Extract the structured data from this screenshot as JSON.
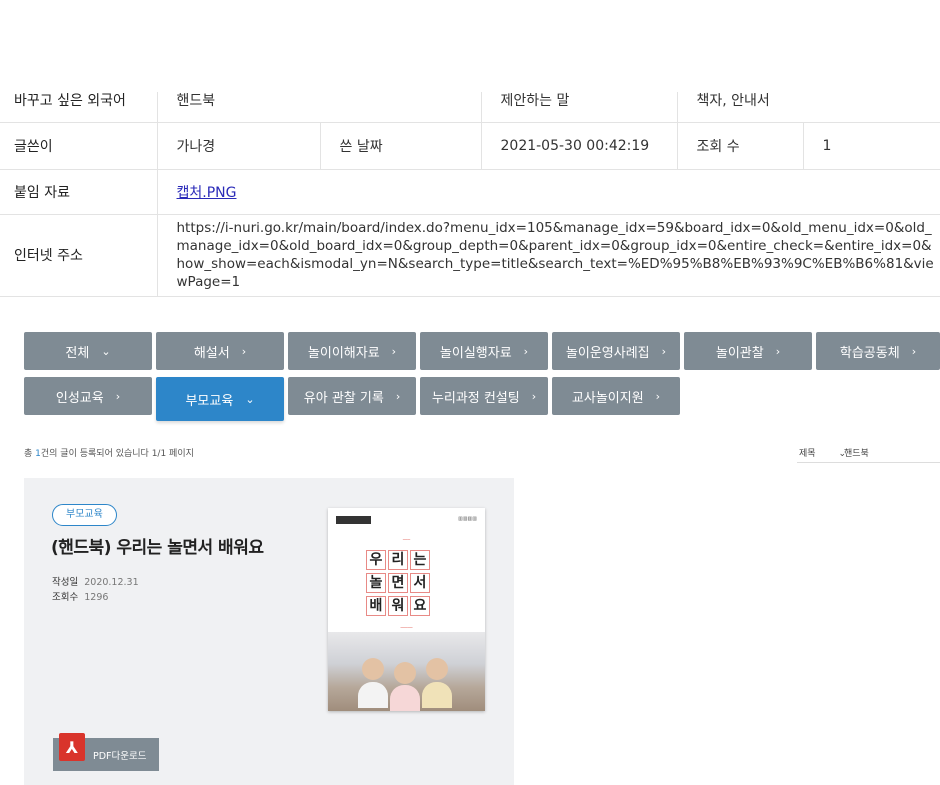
{
  "info": {
    "row_lang_label": "바꾸고 싶은 외국어",
    "row_lang_value": "핸드북",
    "row_suggest_label": "제안하는 말",
    "row_suggest_value": "책자, 안내서",
    "author_label": "글쓴이",
    "author_value": "가나경",
    "date_label": "쓴 날짜",
    "date_value": "2021-05-30 00:42:19",
    "views_label": "조회 수",
    "views_value": "1",
    "attach_label": "붙임 자료",
    "attach_file": "캡처.PNG",
    "url_label": "인터넷 주소",
    "url_value": "https://i-nuri.go.kr/main/board/index.do?menu_idx=105&manage_idx=59&board_idx=0&old_menu_idx=0&old_manage_idx=0&old_board_idx=0&group_depth=0&parent_idx=0&group_idx=0&entire_check=&entire_idx=0&how_show=each&ismodal_yn=N&search_type=title&search_text=%ED%95%B8%EB%93%9C%EB%B6%81&viewPage=1"
  },
  "categories": {
    "row1": [
      "전체",
      "해설서",
      "놀이이해자료",
      "놀이실행자료",
      "놀이운영사례집",
      "놀이관찰",
      "학습공동체"
    ],
    "row2": [
      "인성교육",
      "부모교육",
      "유아 관찰 기록",
      "누리과정 컨설팅",
      "교사놀이지원"
    ],
    "active": "부모교육"
  },
  "summary": {
    "prefix": "총 ",
    "count": "1",
    "suffix": "건의 글이 등록되어 있습니다 1/1 페이지"
  },
  "search": {
    "type_label": "제목",
    "value": "핸드북"
  },
  "card": {
    "badge": "부모교육",
    "title": "(핸드북) 우리는 놀면서 배워요",
    "date_label": "작성일",
    "date_value": "2020.12.31",
    "views_label": "조회수",
    "views_value": "1296",
    "pdf_label": "PDF다운로드",
    "book_chars": [
      "우",
      "리",
      "는",
      "놀",
      "면",
      "서",
      "배",
      "워",
      "요"
    ]
  },
  "colors": {
    "button_gray": "#7f8b94",
    "accent_blue": "#2d86c9",
    "pdf_red": "#d9342b"
  }
}
